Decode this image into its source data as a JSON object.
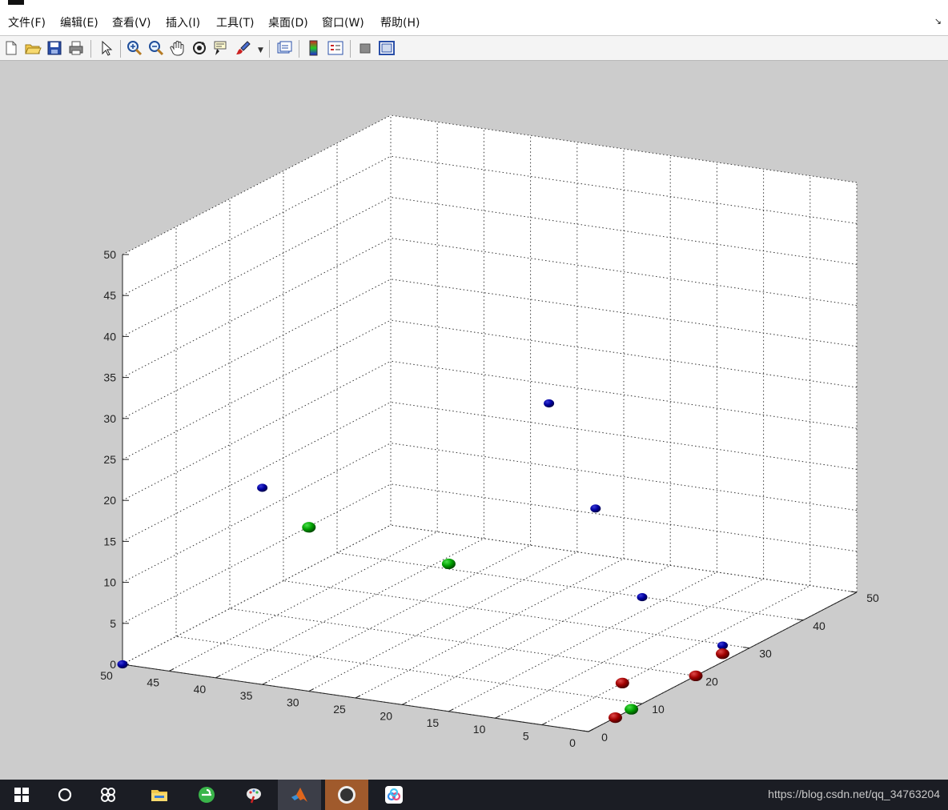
{
  "menu": {
    "items": [
      "文件(F)",
      "编辑(E)",
      "查看(V)",
      "插入(I)",
      "工具(T)",
      "桌面(D)",
      "窗口(W)",
      "帮助(H)"
    ],
    "corner_icon": "dock-arrow-icon"
  },
  "toolbar": {
    "buttons": [
      "new-figure",
      "open-file",
      "save",
      "print",
      "edit-plot",
      "zoom-in",
      "zoom-out",
      "pan",
      "rotate-3d",
      "data-cursor",
      "brush",
      "link-plot",
      "colorbar",
      "legend",
      "hide-plot-tools",
      "show-plot-tools"
    ]
  },
  "axes": {
    "z_ticks": [
      "0",
      "5",
      "10",
      "15",
      "20",
      "25",
      "30",
      "35",
      "40",
      "45",
      "50"
    ],
    "y_ticks": [
      "0",
      "10",
      "20",
      "30",
      "40",
      "50"
    ],
    "x_ticks": [
      "0",
      "5",
      "10",
      "15",
      "20",
      "25",
      "30",
      "35",
      "40",
      "45",
      "50"
    ],
    "grid": true
  },
  "chart_data": {
    "type": "scatter",
    "dimension": "3d",
    "xlim": [
      0,
      50
    ],
    "ylim": [
      0,
      50
    ],
    "zlim": [
      0,
      50
    ],
    "grid": true,
    "colors": {
      "blue": "#0000a0",
      "green": "#00a000",
      "red": "#a00000"
    },
    "series": [
      {
        "color": "#0000a0",
        "points": [
          [
            50,
            0,
            0
          ],
          [
            35,
            0,
            24
          ],
          [
            10,
            10,
            35
          ],
          [
            5,
            10,
            23
          ],
          [
            0,
            10,
            13
          ],
          [
            0,
            25,
            2
          ]
        ]
      },
      {
        "color": "#00a000",
        "points": [
          [
            30,
            0,
            20
          ],
          [
            15,
            0,
            18
          ],
          [
            0,
            8,
            0
          ]
        ]
      },
      {
        "color": "#a00000",
        "points": [
          [
            0,
            25,
            1
          ],
          [
            5,
            15,
            0
          ],
          [
            0,
            20,
            0
          ],
          [
            0,
            5,
            0
          ]
        ]
      }
    ]
  },
  "taskbar": {
    "apps": [
      "windows-start",
      "cortana-search",
      "task-view",
      "file-explorer",
      "browser",
      "paint",
      "matlab",
      "user-avatar",
      "baidu-netdisk"
    ],
    "watermark": "https://blog.csdn.net/qq_34763204"
  }
}
